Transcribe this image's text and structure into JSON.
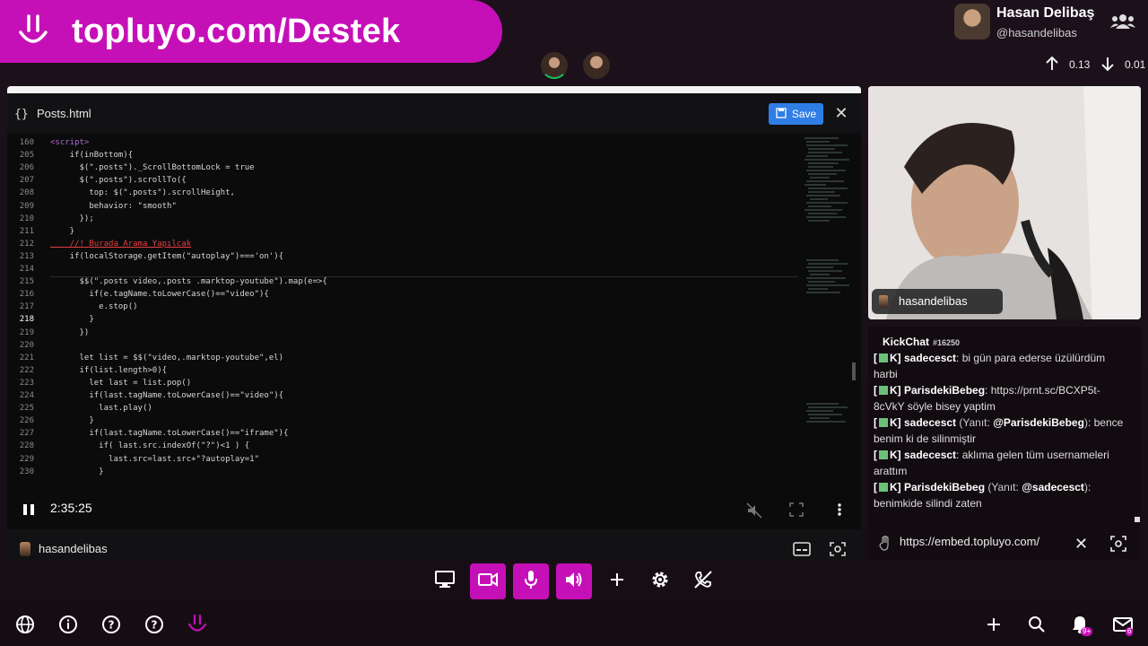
{
  "banner": {
    "text": "topluyo.com/Destek"
  },
  "user": {
    "name": "Hasan Delibaş",
    "handle": "@hasandelibas"
  },
  "net": {
    "up": "0.13",
    "down": "0.01"
  },
  "editor": {
    "file": "Posts.html",
    "save_label": "Save",
    "lines": [
      {
        "n": "160",
        "c": "<script>"
      },
      {
        "n": "205",
        "c": "    if(inBottom){"
      },
      {
        "n": "206",
        "c": "      $(\".posts\")._ScrollBottomLock = true"
      },
      {
        "n": "207",
        "c": "      $(\".posts\").scrollTo({"
      },
      {
        "n": "208",
        "c": "        top: $(\".posts\").scrollHeight,"
      },
      {
        "n": "209",
        "c": "        behavior: \"smooth\""
      },
      {
        "n": "210",
        "c": "      });"
      },
      {
        "n": "211",
        "c": "    }"
      },
      {
        "n": "212",
        "c": "    //! Burada Arama Yapılcak"
      },
      {
        "n": "213",
        "c": "    if(localStorage.getItem(\"autoplay\")==='on'){"
      },
      {
        "n": "214",
        "c": ""
      },
      {
        "n": "215",
        "c": "      $$(\".posts video,.posts .marktop-youtube\").map(e=>{"
      },
      {
        "n": "216",
        "c": "        if(e.tagName.toLowerCase()==\"video\"){"
      },
      {
        "n": "217",
        "c": "          e.stop()"
      },
      {
        "n": "218",
        "c": "        }"
      },
      {
        "n": "219",
        "c": "      })"
      },
      {
        "n": "220",
        "c": ""
      },
      {
        "n": "221",
        "c": "      let list = $$(\"video,.marktop-youtube\",el)"
      },
      {
        "n": "222",
        "c": "      if(list.length>0){"
      },
      {
        "n": "223",
        "c": "        let last = list.pop()"
      },
      {
        "n": "224",
        "c": "        if(last.tagName.toLowerCase()==\"video\"){"
      },
      {
        "n": "225",
        "c": "          last.play()"
      },
      {
        "n": "226",
        "c": "        }"
      },
      {
        "n": "227",
        "c": "        if(last.tagName.toLowerCase()==\"iframe\"){"
      },
      {
        "n": "228",
        "c": "          if( last.src.indexOf(\"?\")<1 ) {"
      },
      {
        "n": "229",
        "c": "            last.src=last.src+\"?autoplay=1\""
      },
      {
        "n": "230",
        "c": "          }"
      }
    ],
    "time": "2:35:25",
    "footer_name": "hasandelibas"
  },
  "cam": {
    "label": "hasandelibas"
  },
  "chat": {
    "title": "KickChat",
    "id": "#16250",
    "messages": [
      {
        "user": "sadecesct",
        "reply": "",
        "text": ": bi gün para ederse üzülürdüm harbi"
      },
      {
        "user": "ParisdekiBebeg",
        "reply": "",
        "text": ": https://prnt.sc/BCXP5t-8cVkY söyle bisey yaptim"
      },
      {
        "user": "sadecesct",
        "reply": "@ParisdekiBebeg",
        "text": ": bence benim ki de silinmiştir"
      },
      {
        "user": "sadecesct",
        "reply": "",
        "text": ": aklıma gelen tüm usernameleri arattım"
      },
      {
        "user": "ParisdekiBebeg",
        "reply": "@sadecesct",
        "text": ": benimkide silindi zaten"
      }
    ],
    "url": "https://embed.topluyo.com/"
  },
  "bottom": {
    "notif_badge": "9+",
    "mail_badge": "6"
  },
  "accent": "#c610b7"
}
